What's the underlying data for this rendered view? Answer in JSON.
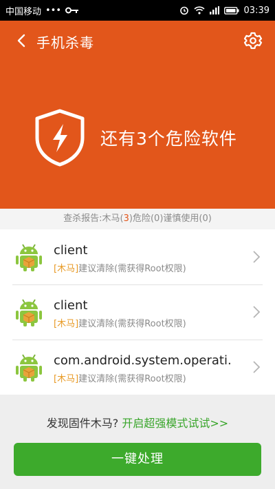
{
  "status_bar": {
    "carrier": "中国移动",
    "dots": "•••",
    "time": "03:39"
  },
  "header": {
    "title": "手机杀毒"
  },
  "hero": {
    "headline": "还有3个危险软件"
  },
  "report": {
    "prefix": "查杀报告:木马(",
    "trojan_count": "3",
    "middle": ")危险(0)谨慎使用(0)"
  },
  "threats": [
    {
      "name": "client",
      "tag": "[木马]",
      "advice": "建议清除(需获得Root权限)"
    },
    {
      "name": "client",
      "tag": "[木马]",
      "advice": "建议清除(需获得Root权限)"
    },
    {
      "name": "com.android.system.operati.",
      "tag": "[木马]",
      "advice": "建议清除(需获得Root权限)"
    }
  ],
  "bottom": {
    "firmware_text": "发现固件木马? ",
    "firmware_link": "开启超强模式试试>>",
    "action_label": "一键处理"
  },
  "colors": {
    "accent_orange": "#e2561b",
    "green": "#3daa2c",
    "tag_orange": "#e89a25"
  }
}
